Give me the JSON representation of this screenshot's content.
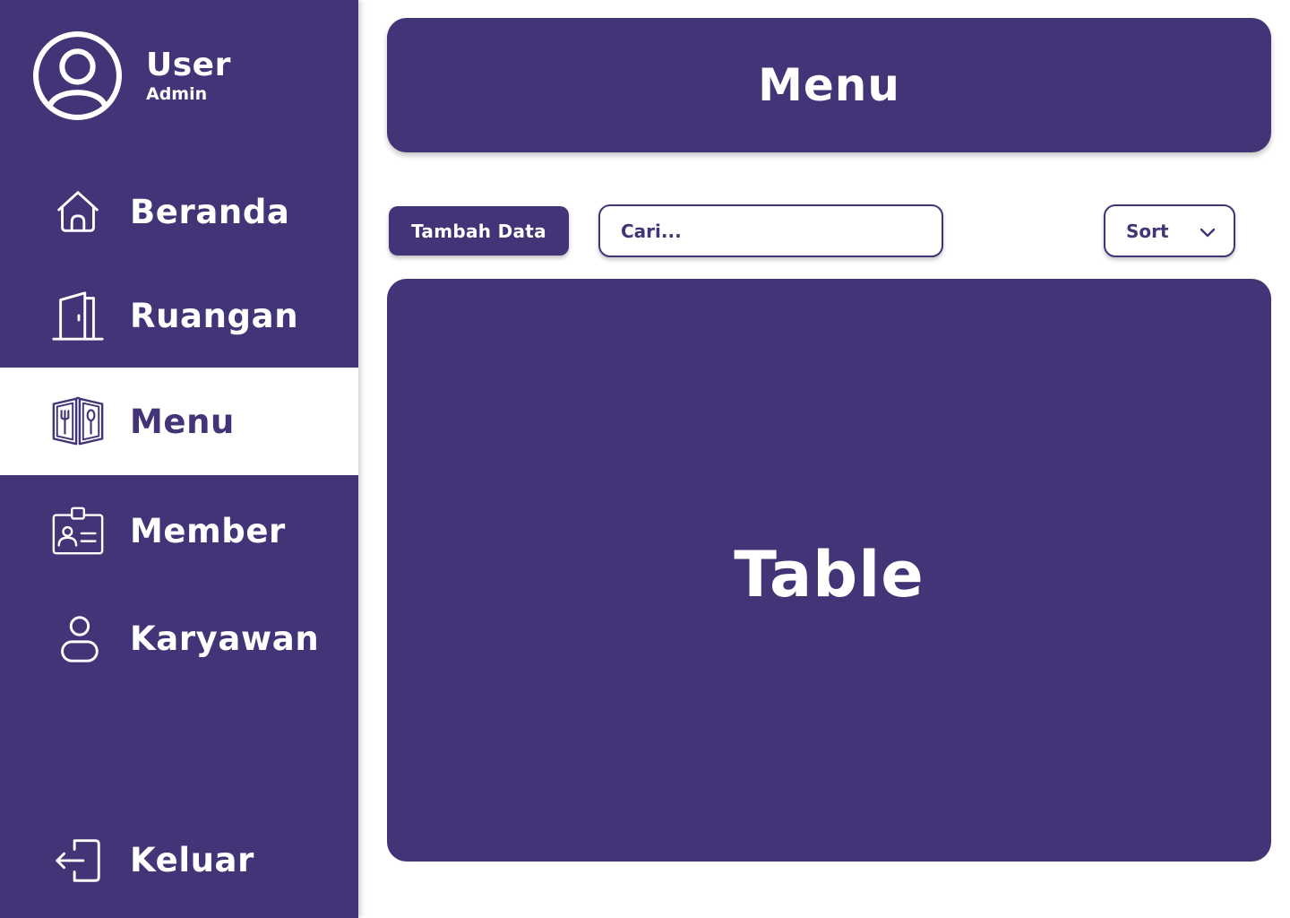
{
  "user": {
    "name": "User",
    "role": "Admin"
  },
  "sidebar": {
    "items": [
      {
        "label": "Beranda",
        "icon": "home-icon",
        "active": false
      },
      {
        "label": "Ruangan",
        "icon": "door-icon",
        "active": false
      },
      {
        "label": "Menu",
        "icon": "menu-book-icon",
        "active": true
      },
      {
        "label": "Member",
        "icon": "id-card-icon",
        "active": false
      },
      {
        "label": "Karyawan",
        "icon": "person-icon",
        "active": false
      }
    ],
    "logout": {
      "label": "Keluar",
      "icon": "logout-icon"
    }
  },
  "header": {
    "title": "Menu"
  },
  "toolbar": {
    "add_label": "Tambah Data",
    "search_placeholder": "Cari...",
    "sort_label": "Sort"
  },
  "main": {
    "table_placeholder": "Table"
  },
  "colors": {
    "primary": "#423476",
    "surface": "#ffffff"
  }
}
